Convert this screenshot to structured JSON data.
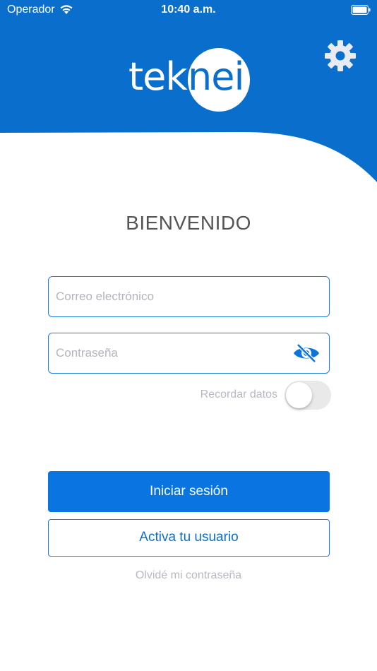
{
  "status_bar": {
    "carrier": "Operador",
    "time": "10:40 a.m."
  },
  "colors": {
    "brand_blue": "#0a6fcc",
    "button_blue": "#0a74e0",
    "muted_text": "#b8b8c4"
  },
  "header": {
    "logo_text_left": "tek",
    "logo_text_right": "nei",
    "settings_icon": "gear-icon"
  },
  "main": {
    "title": "BIENVENIDO",
    "email_placeholder": "Correo electrónico",
    "email_value": "",
    "password_placeholder": "Contraseña",
    "password_value": "",
    "password_visibility_icon": "eye-slash-icon",
    "remember_label": "Recordar datos",
    "remember_enabled": false,
    "login_button": "Iniciar sesión",
    "activate_button": "Activa tu usuario",
    "forgot_link": "Olvidé mi contraseña"
  }
}
